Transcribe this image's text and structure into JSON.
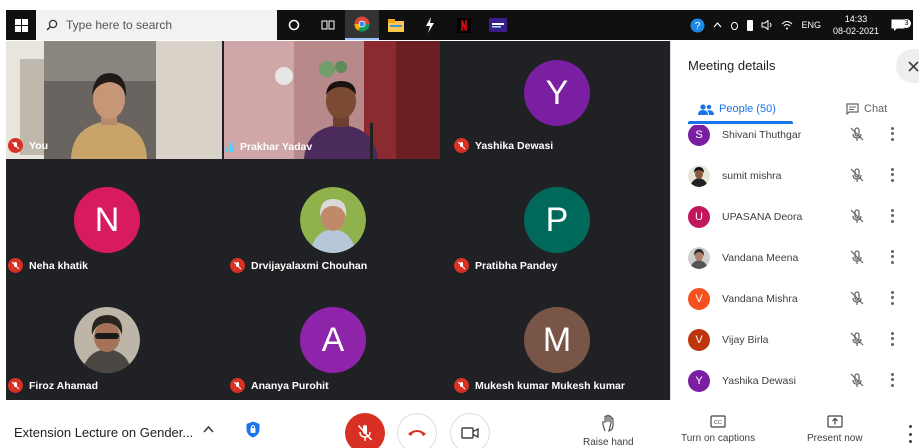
{
  "taskbar": {
    "search_placeholder": "Type here to search",
    "language": "ENG",
    "time": "14:33",
    "date": "08-02-2021",
    "notification_count": "3"
  },
  "tiles": [
    {
      "name": "You",
      "state": "muted",
      "type": "video"
    },
    {
      "name": "Prakhar Yadav",
      "state": "speaking",
      "type": "video"
    },
    {
      "name": "Yashika Dewasi",
      "state": "muted",
      "type": "avatar",
      "initial": "Y",
      "color": "#7b1fa2"
    },
    {
      "name": "Neha khatik",
      "state": "muted",
      "type": "avatar",
      "initial": "N",
      "color": "#d81b60"
    },
    {
      "name": "Drvijayalaxmi Chouhan",
      "state": "muted",
      "type": "photo"
    },
    {
      "name": "Pratibha Pandey",
      "state": "muted",
      "type": "avatar",
      "initial": "P",
      "color": "#00695c"
    },
    {
      "name": "Firoz Ahamad",
      "state": "muted",
      "type": "photo"
    },
    {
      "name": "Ananya Purohit",
      "state": "muted",
      "type": "avatar",
      "initial": "A",
      "color": "#8e24aa"
    },
    {
      "name": "Mukesh kumar Mukesh kumar",
      "state": "muted",
      "type": "avatar",
      "initial": "M",
      "color": "#795548"
    }
  ],
  "panel": {
    "title": "Meeting details",
    "tab_people": "People (50)",
    "tab_chat": "Chat",
    "people": [
      {
        "name": "Shivani Thuthgar",
        "initial": "S",
        "color": "#7b1fa2",
        "photo": false
      },
      {
        "name": "sumit mishra",
        "initial": "",
        "color": "#3e3e3e",
        "photo": true
      },
      {
        "name": "UPASANA Deora",
        "initial": "U",
        "color": "#c2185b",
        "photo": false
      },
      {
        "name": "Vandana Meena",
        "initial": "",
        "color": "#9e9e9e",
        "photo": true
      },
      {
        "name": "Vandana Mishra",
        "initial": "V",
        "color": "#f4511e",
        "photo": false
      },
      {
        "name": "Vijay Birla",
        "initial": "V",
        "color": "#bf360c",
        "photo": false
      },
      {
        "name": "Yashika Dewasi",
        "initial": "Y",
        "color": "#7b1fa2",
        "photo": false
      }
    ]
  },
  "bottom": {
    "meeting_name": "Extension Lecture on Gender...",
    "raise_hand": "Raise hand",
    "captions": "Turn on captions",
    "present": "Present now"
  }
}
